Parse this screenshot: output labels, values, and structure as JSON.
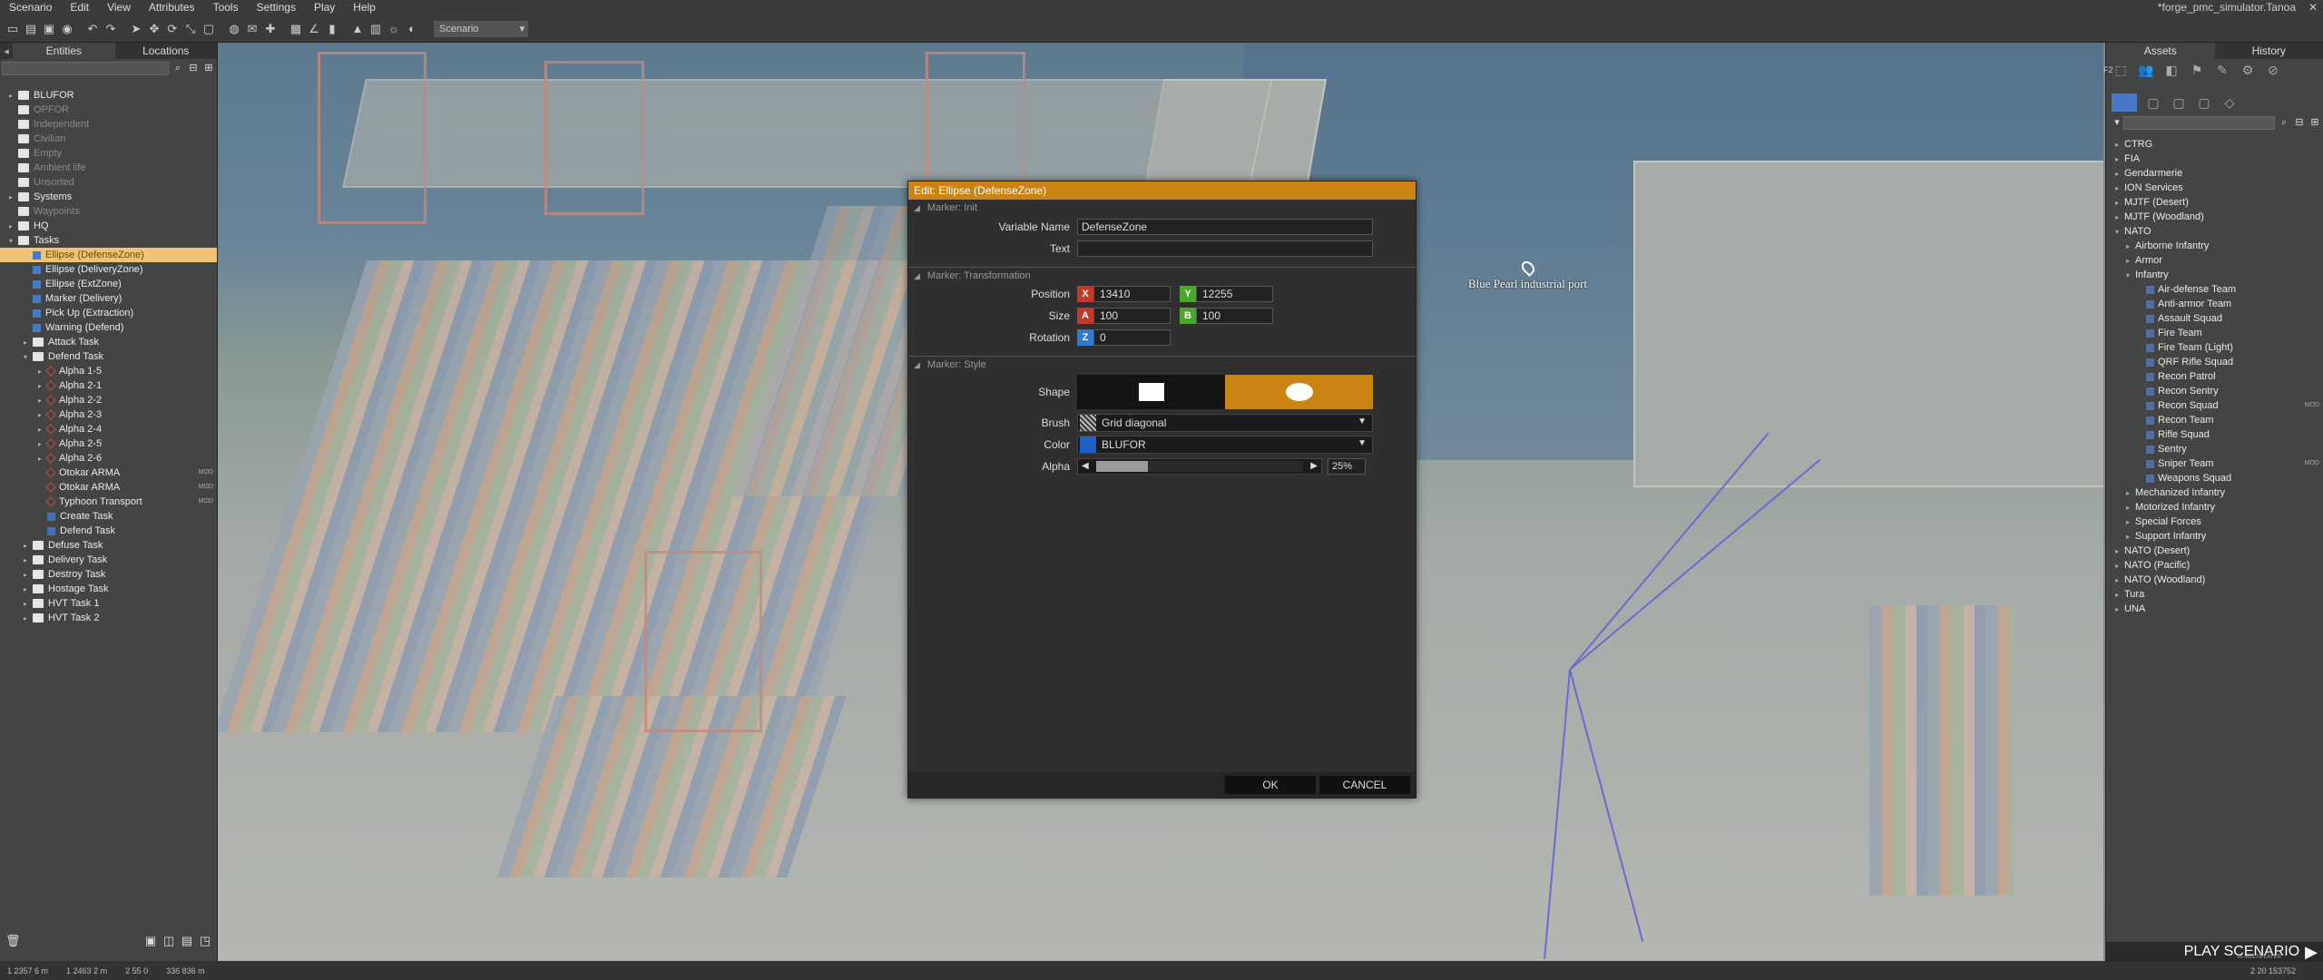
{
  "menu": {
    "items": [
      "Scenario",
      "Edit",
      "View",
      "Attributes",
      "Tools",
      "Settings",
      "Play",
      "Help"
    ],
    "window_title": "*forge_pmc_simulator.Tanoa"
  },
  "toolbar": {
    "scenario": "Scenario"
  },
  "left_panel": {
    "tabs": [
      "Entities",
      "Locations"
    ],
    "tree": [
      {
        "label": "BLUFOR",
        "indent": 0,
        "icon": "folder",
        "exp": "▸",
        "dim": false
      },
      {
        "label": "OPFOR",
        "indent": 0,
        "icon": "folder",
        "exp": "",
        "dim": true
      },
      {
        "label": "Independent",
        "indent": 0,
        "icon": "folder",
        "exp": "",
        "dim": true
      },
      {
        "label": "Civilian",
        "indent": 0,
        "icon": "folder",
        "exp": "",
        "dim": true
      },
      {
        "label": "Empty",
        "indent": 0,
        "icon": "folder",
        "exp": "",
        "dim": true
      },
      {
        "label": "Ambient life",
        "indent": 0,
        "icon": "folder",
        "exp": "",
        "dim": true
      },
      {
        "label": "Unsorted",
        "indent": 0,
        "icon": "folder",
        "exp": "",
        "dim": true
      },
      {
        "label": "Systems",
        "indent": 0,
        "icon": "folder",
        "exp": "▸",
        "dim": false
      },
      {
        "label": "Waypoints",
        "indent": 0,
        "icon": "folder",
        "exp": "",
        "dim": true
      },
      {
        "label": "HQ",
        "indent": 0,
        "icon": "folder",
        "exp": "▸",
        "dim": false
      },
      {
        "label": "Tasks",
        "indent": 0,
        "icon": "folder",
        "exp": "▾",
        "dim": false
      },
      {
        "label": "Ellipse (DefenseZone)",
        "indent": 1,
        "icon": "marker",
        "exp": "",
        "dim": false,
        "selected": true
      },
      {
        "label": "Ellipse (DeliveryZone)",
        "indent": 1,
        "icon": "marker",
        "exp": "",
        "dim": false
      },
      {
        "label": "Ellipse (ExtZone)",
        "indent": 1,
        "icon": "marker",
        "exp": "",
        "dim": false
      },
      {
        "label": "Marker (Delivery)",
        "indent": 1,
        "icon": "marker",
        "exp": "",
        "dim": false
      },
      {
        "label": "Pick Up (Extraction)",
        "indent": 1,
        "icon": "marker",
        "exp": "",
        "dim": false
      },
      {
        "label": "Warning (Defend)",
        "indent": 1,
        "icon": "marker",
        "exp": "",
        "dim": false
      },
      {
        "label": "Attack Task",
        "indent": 1,
        "icon": "folder",
        "exp": "▸",
        "dim": false
      },
      {
        "label": "Defend Task",
        "indent": 1,
        "icon": "folder",
        "exp": "▾",
        "dim": false
      },
      {
        "label": "Alpha 1-5",
        "indent": 2,
        "icon": "diamond",
        "exp": "▸",
        "dim": false
      },
      {
        "label": "Alpha 2-1",
        "indent": 2,
        "icon": "diamond",
        "exp": "▸",
        "dim": false
      },
      {
        "label": "Alpha 2-2",
        "indent": 2,
        "icon": "diamond",
        "exp": "▸",
        "dim": false
      },
      {
        "label": "Alpha 2-3",
        "indent": 2,
        "icon": "diamond",
        "exp": "▸",
        "dim": false
      },
      {
        "label": "Alpha 2-4",
        "indent": 2,
        "icon": "diamond",
        "exp": "▸",
        "dim": false
      },
      {
        "label": "Alpha 2-5",
        "indent": 2,
        "icon": "diamond",
        "exp": "▸",
        "dim": false
      },
      {
        "label": "Alpha 2-6",
        "indent": 2,
        "icon": "diamond",
        "exp": "▸",
        "dim": false
      },
      {
        "label": "Otokar ARMA",
        "indent": 2,
        "icon": "diamond",
        "exp": "",
        "dim": false,
        "badge": "MOD"
      },
      {
        "label": "Otokar ARMA",
        "indent": 2,
        "icon": "diamond",
        "exp": "",
        "dim": false,
        "badge": "MOD"
      },
      {
        "label": "Typhoon Transport",
        "indent": 2,
        "icon": "diamond",
        "exp": "",
        "dim": false,
        "badge": "MOD"
      },
      {
        "label": "Create Task",
        "indent": 2,
        "icon": "square",
        "exp": "",
        "dim": false
      },
      {
        "label": "Defend Task",
        "indent": 2,
        "icon": "square",
        "exp": "",
        "dim": false
      },
      {
        "label": "Defuse Task",
        "indent": 1,
        "icon": "folder",
        "exp": "▸",
        "dim": false
      },
      {
        "label": "Delivery Task",
        "indent": 1,
        "icon": "folder",
        "exp": "▸",
        "dim": false
      },
      {
        "label": "Destroy Task",
        "indent": 1,
        "icon": "folder",
        "exp": "▸",
        "dim": false
      },
      {
        "label": "Hostage Task",
        "indent": 1,
        "icon": "folder",
        "exp": "▸",
        "dim": false
      },
      {
        "label": "HVT Task 1",
        "indent": 1,
        "icon": "folder",
        "exp": "▸",
        "dim": false
      },
      {
        "label": "HVT Task 2",
        "indent": 1,
        "icon": "folder",
        "exp": "▸",
        "dim": false
      }
    ]
  },
  "right_panel": {
    "tabs": [
      "Assets",
      "History"
    ],
    "category_label": "F2",
    "tree": [
      {
        "label": "CTRG",
        "indent": 0,
        "exp": "▸"
      },
      {
        "label": "FIA",
        "indent": 0,
        "exp": "▸"
      },
      {
        "label": "Gendarmerie",
        "indent": 0,
        "exp": "▸"
      },
      {
        "label": "ION Services",
        "indent": 0,
        "exp": "▸"
      },
      {
        "label": "MJTF (Desert)",
        "indent": 0,
        "exp": "▸"
      },
      {
        "label": "MJTF (Woodland)",
        "indent": 0,
        "exp": "▸"
      },
      {
        "label": "NATO",
        "indent": 0,
        "exp": "▾"
      },
      {
        "label": "Airborne Infantry",
        "indent": 1,
        "exp": "▸"
      },
      {
        "label": "Armor",
        "indent": 1,
        "exp": "▸"
      },
      {
        "label": "Infantry",
        "indent": 1,
        "exp": "▾"
      },
      {
        "label": "Air-defense Team",
        "indent": 2,
        "exp": "",
        "icon": true
      },
      {
        "label": "Anti-armor Team",
        "indent": 2,
        "exp": "",
        "icon": true
      },
      {
        "label": "Assault Squad",
        "indent": 2,
        "exp": "",
        "icon": true
      },
      {
        "label": "Fire Team",
        "indent": 2,
        "exp": "",
        "icon": true
      },
      {
        "label": "Fire Team (Light)",
        "indent": 2,
        "exp": "",
        "icon": true
      },
      {
        "label": "QRF Rifle Squad",
        "indent": 2,
        "exp": "",
        "icon": true
      },
      {
        "label": "Recon Patrol",
        "indent": 2,
        "exp": "",
        "icon": true
      },
      {
        "label": "Recon Sentry",
        "indent": 2,
        "exp": "",
        "icon": true
      },
      {
        "label": "Recon Squad",
        "indent": 2,
        "exp": "",
        "icon": true,
        "badge": "MOD"
      },
      {
        "label": "Recon Team",
        "indent": 2,
        "exp": "",
        "icon": true
      },
      {
        "label": "Rifle Squad",
        "indent": 2,
        "exp": "",
        "icon": true
      },
      {
        "label": "Sentry",
        "indent": 2,
        "exp": "",
        "icon": true
      },
      {
        "label": "Sniper Team",
        "indent": 2,
        "exp": "",
        "icon": true,
        "badge": "MOD"
      },
      {
        "label": "Weapons Squad",
        "indent": 2,
        "exp": "",
        "icon": true
      },
      {
        "label": "Mechanized Infantry",
        "indent": 1,
        "exp": "▸"
      },
      {
        "label": "Motorized Infantry",
        "indent": 1,
        "exp": "▸"
      },
      {
        "label": "Special Forces",
        "indent": 1,
        "exp": "▸"
      },
      {
        "label": "Support Infantry",
        "indent": 1,
        "exp": "▸"
      },
      {
        "label": "NATO (Desert)",
        "indent": 0,
        "exp": "▸"
      },
      {
        "label": "NATO (Pacific)",
        "indent": 0,
        "exp": "▸"
      },
      {
        "label": "NATO (Woodland)",
        "indent": 0,
        "exp": "▸"
      },
      {
        "label": "Tura",
        "indent": 0,
        "exp": "▸"
      },
      {
        "label": "UNA",
        "indent": 0,
        "exp": "▸"
      }
    ]
  },
  "map": {
    "label": "Blue Pearl industrial port"
  },
  "dialog": {
    "title": "Edit: Ellipse (DefenseZone)",
    "sections": {
      "init": "Marker: Init",
      "transform": "Marker: Transformation",
      "style": "Marker: Style"
    },
    "labels": {
      "variable_name": "Variable Name",
      "text": "Text",
      "position": "Position",
      "size": "Size",
      "rotation": "Rotation",
      "shape": "Shape",
      "brush": "Brush",
      "color": "Color",
      "alpha": "Alpha"
    },
    "values": {
      "variable_name": "DefenseZone",
      "text": "",
      "pos_x": "13410",
      "pos_y": "12255",
      "size_a": "100",
      "size_b": "100",
      "rot_z": "0",
      "brush": "Grid diagonal",
      "color": "BLUFOR",
      "alpha_pct": "25%",
      "alpha_fraction": 0.25
    },
    "axis": {
      "x": "X",
      "y": "Y",
      "a": "A",
      "b": "B",
      "z": "Z"
    },
    "ok": "OK",
    "cancel": "CANCEL"
  },
  "play": {
    "label": "PLAY SCENARIO",
    "sub": "IN MULTIPLAYER"
  },
  "status": {
    "items": [
      "1 2357  6 m",
      "1 2463  2 m",
      "2 55  0",
      "336  836 m"
    ],
    "right": "2  20  153752"
  },
  "colors": {
    "accent": "#cb8312",
    "selection": "#f2c276",
    "blufor": "#1f5fc9"
  }
}
